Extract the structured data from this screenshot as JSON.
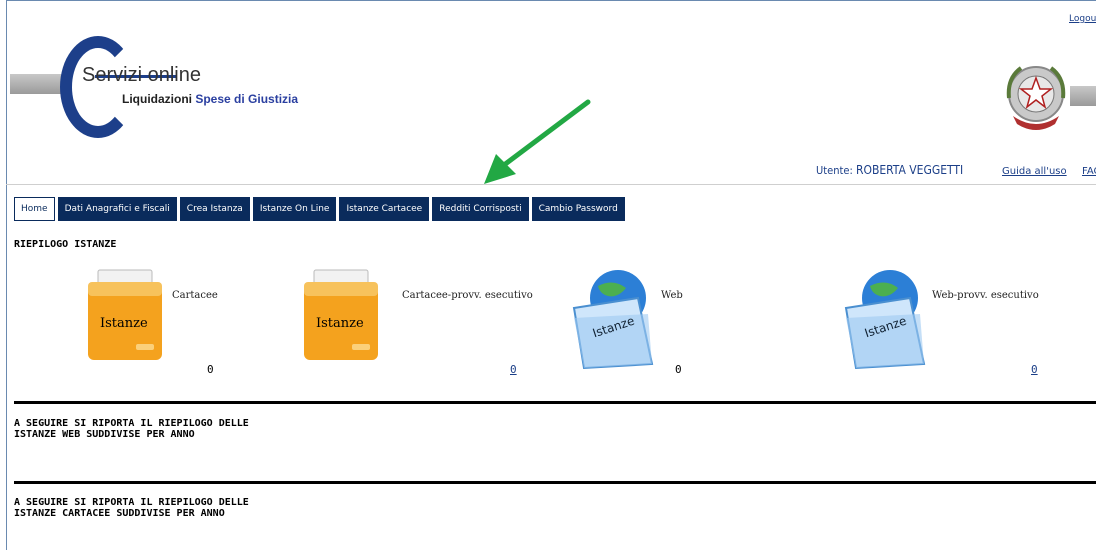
{
  "header": {
    "logout": "Logout",
    "logo": {
      "title": "Servizi online",
      "subtitle_1": "Liquidazioni",
      "subtitle_2": "Spese di Giustizia"
    },
    "user_label": "Utente:",
    "user_name": "ROBERTA VEGGETTI",
    "guide": "Guida all'uso",
    "faq": "FAQ"
  },
  "nav": {
    "tabs": [
      "Home",
      "Dati Anagrafici e Fiscali",
      "Crea Istanza",
      "Istanze On Line",
      "Istanze Cartacee",
      "Redditi Corrisposti",
      "Cambio Password"
    ]
  },
  "main": {
    "section_title": "RIEPILOGO ISTANZE",
    "cards": [
      {
        "label": "Cartacee",
        "icon_text": "Istanze",
        "count": "0",
        "icon": "folder-orange-icon"
      },
      {
        "label": "Cartacee-provv. esecutivo",
        "icon_text": "Istanze",
        "count": "0",
        "icon": "folder-orange-icon"
      },
      {
        "label": "Web",
        "icon_text": "Istanze",
        "count": "0",
        "icon": "folder-globe-icon"
      },
      {
        "label": "Web-provv. esecutivo",
        "icon_text": "Istanze",
        "count": "0",
        "icon": "folder-globe-icon"
      }
    ],
    "summary_web": [
      "A SEGUIRE SI RIPORTA IL RIEPILOGO DELLE",
      "ISTANZE WEB SUDDIVISE PER ANNO"
    ],
    "summary_paper": [
      "A SEGUIRE SI RIPORTA IL RIEPILOGO DELLE",
      "ISTANZE CARTACEE SUDDIVISE PER ANNO"
    ]
  },
  "colors": {
    "nav_bg": "#0a2b5c",
    "link": "#1c3f88",
    "arrow": "#22a844",
    "folder": "#f5a623"
  }
}
